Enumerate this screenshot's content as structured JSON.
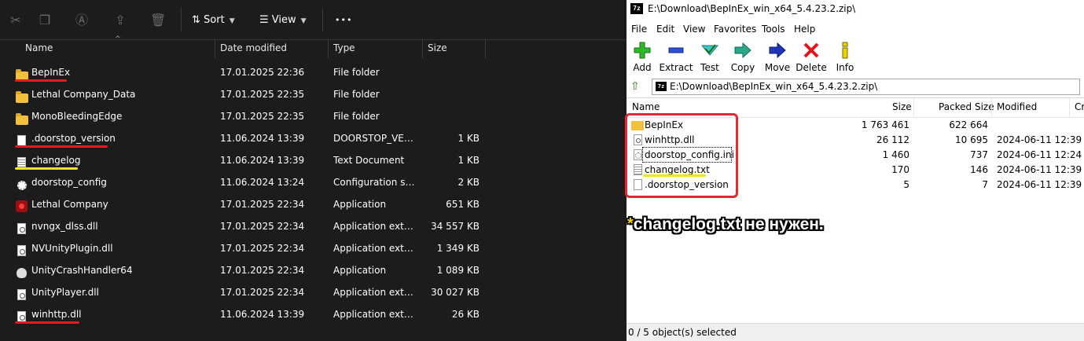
{
  "explorer": {
    "toolbar": {
      "sort_label": "Sort",
      "view_label": "View",
      "more_label": "•••"
    },
    "columns": {
      "name": "Name",
      "date": "Date modified",
      "type": "Type",
      "size": "Size"
    },
    "rows": [
      {
        "name": "BepInEx",
        "date": "17.01.2025 22:36",
        "type": "File folder",
        "size": "",
        "icon": "folder-icon"
      },
      {
        "name": "Lethal Company_Data",
        "date": "17.01.2025 22:35",
        "type": "File folder",
        "size": "",
        "icon": "folder-icon"
      },
      {
        "name": "MonoBleedingEdge",
        "date": "17.01.2025 22:35",
        "type": "File folder",
        "size": "",
        "icon": "folder-icon"
      },
      {
        "name": ".doorstop_version",
        "date": "11.06.2024 13:39",
        "type": "DOORSTOP_VERSI...",
        "size": "1 KB",
        "icon": "file-icon"
      },
      {
        "name": "changelog",
        "date": "11.06.2024 13:39",
        "type": "Text Document",
        "size": "1 KB",
        "icon": "text-file-icon"
      },
      {
        "name": "doorstop_config",
        "date": "11.06.2024 13:24",
        "type": "Configuration sett...",
        "size": "2 KB",
        "icon": "config-file-icon"
      },
      {
        "name": "Lethal Company",
        "date": "17.01.2025 22:34",
        "type": "Application",
        "size": "651 KB",
        "icon": "app-icon"
      },
      {
        "name": "nvngx_dlss.dll",
        "date": "17.01.2025 22:34",
        "type": "Application exten...",
        "size": "34 557 KB",
        "icon": "dll-icon"
      },
      {
        "name": "NVUnityPlugin.dll",
        "date": "17.01.2025 22:34",
        "type": "Application exten...",
        "size": "1 349 KB",
        "icon": "dll-icon"
      },
      {
        "name": "UnityCrashHandler64",
        "date": "17.01.2025 22:34",
        "type": "Application",
        "size": "1 089 KB",
        "icon": "unity-icon"
      },
      {
        "name": "UnityPlayer.dll",
        "date": "17.01.2025 22:34",
        "type": "Application exten...",
        "size": "30 027 KB",
        "icon": "dll-icon"
      },
      {
        "name": "winhttp.dll",
        "date": "11.06.2024 13:39",
        "type": "Application exten...",
        "size": "26 KB",
        "icon": "dll-icon"
      }
    ]
  },
  "sevenzip": {
    "title": "E:\\Download\\BepInEx_win_x64_5.4.23.2.zip\\",
    "logo": "7z",
    "menu": [
      "File",
      "Edit",
      "View",
      "Favorites",
      "Tools",
      "Help"
    ],
    "tools": [
      "Add",
      "Extract",
      "Test",
      "Copy",
      "Move",
      "Delete",
      "Info"
    ],
    "address": "E:\\Download\\BepInEx_win_x64_5.4.23.2.zip\\",
    "columns": {
      "name": "Name",
      "size": "Size",
      "packed": "Packed Size",
      "modified": "Modified",
      "cr": "Cr"
    },
    "rows": [
      {
        "name": "BepInEx",
        "size": "1 763 461",
        "packed": "622 664",
        "modified": ""
      },
      {
        "name": "winhttp.dll",
        "size": "26 112",
        "packed": "10 695",
        "modified": "2024-06-11 12:39"
      },
      {
        "name": "doorstop_config.ini",
        "size": "1 460",
        "packed": "737",
        "modified": "2024-06-11 12:24"
      },
      {
        "name": "changelog.txt",
        "size": "170",
        "packed": "146",
        "modified": "2024-06-11 12:39"
      },
      {
        "name": ".doorstop_version",
        "size": "5",
        "packed": "7",
        "modified": "2024-06-11 12:39"
      }
    ],
    "status": "0 / 5 object(s) selected"
  },
  "annotation": {
    "star": "*",
    "note": "changelog.txt не нужен.",
    "colors": {
      "red": "#e31b23",
      "yellow": "#f2e51c"
    }
  }
}
